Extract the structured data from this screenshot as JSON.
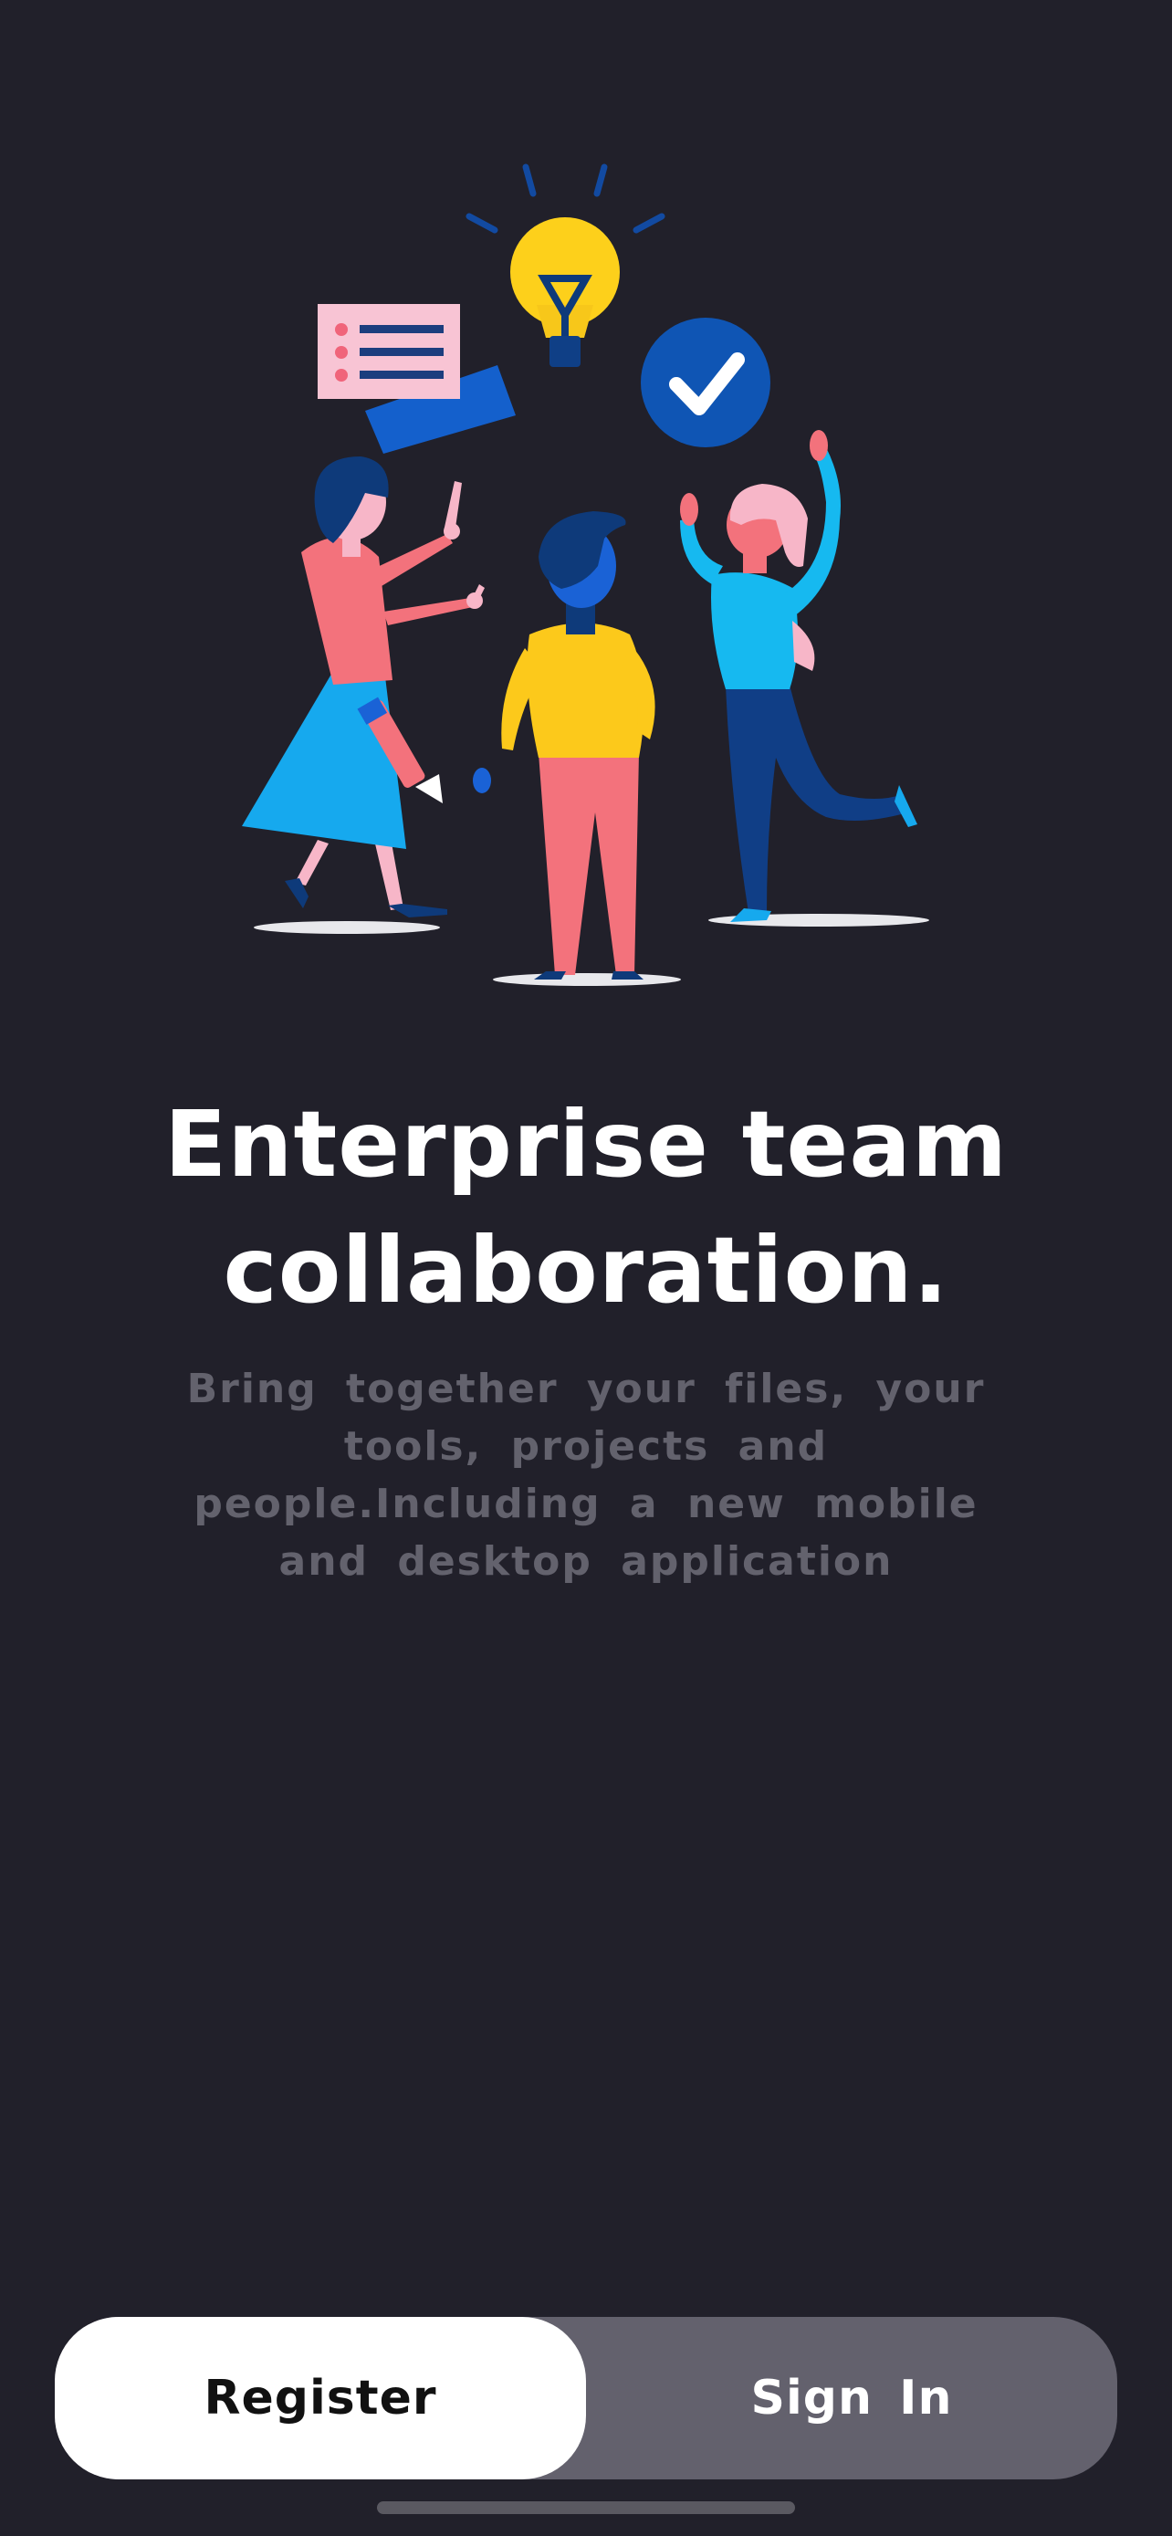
{
  "onboarding": {
    "title": "Enterprise team collaboration.",
    "subtitle": "Bring together your files, your tools, projects and people.Including a new mobile and desktop application"
  },
  "actions": {
    "register_label": "Register",
    "signin_label": "Sign In"
  },
  "colors": {
    "background": "#21202a",
    "title": "#ffffff",
    "subtitle": "#63626d",
    "segment_track": "#63616d",
    "segment_active": "#ffffff"
  },
  "illustration": {
    "icons": [
      "lightbulb-icon",
      "checkmark-badge-icon",
      "document-list-icon",
      "pencil-icon"
    ],
    "people": [
      "woman-in-blue-skirt",
      "man-in-yellow-shirt",
      "woman-cheering-in-cyan"
    ]
  }
}
